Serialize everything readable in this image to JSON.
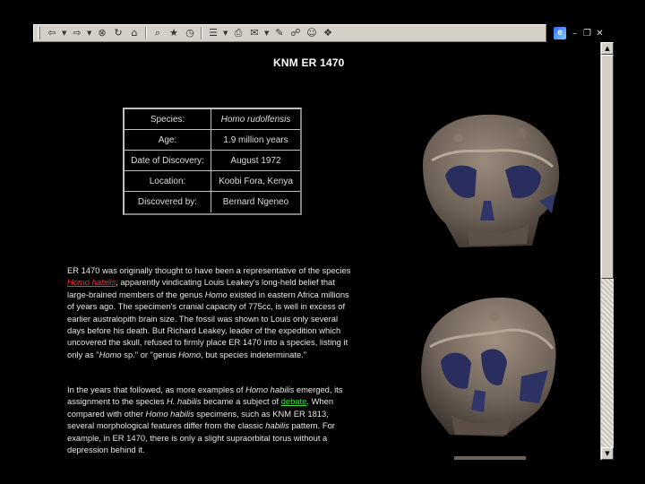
{
  "toolbar": {
    "buttons": [
      {
        "name": "back",
        "glyph": "⇦"
      },
      {
        "name": "forward",
        "glyph": "⇨"
      },
      {
        "name": "stop",
        "glyph": "⊗"
      },
      {
        "name": "refresh",
        "glyph": "↻"
      },
      {
        "name": "home",
        "glyph": "⌂"
      },
      {
        "name": "search",
        "glyph": "⌕"
      },
      {
        "name": "favorites",
        "glyph": "★"
      },
      {
        "name": "history",
        "glyph": "◷"
      },
      {
        "name": "channels",
        "glyph": "☰"
      },
      {
        "name": "print",
        "glyph": "⎙"
      },
      {
        "name": "mail",
        "glyph": "✉"
      },
      {
        "name": "edit",
        "glyph": "✎"
      },
      {
        "name": "discuss",
        "glyph": "☍"
      },
      {
        "name": "messenger",
        "glyph": "☺"
      },
      {
        "name": "research",
        "glyph": "❖"
      }
    ]
  },
  "window": {
    "logo": "e",
    "minimize": "–",
    "restore": "❐",
    "close": "✕"
  },
  "page": {
    "title": "KNM ER 1470",
    "facts": [
      {
        "label": "Species:",
        "value": "Homo rudolfensis",
        "italic": true
      },
      {
        "label": "Age:",
        "value": "1.9 million years",
        "italic": false
      },
      {
        "label": "Date of Discovery:",
        "value": "August 1972",
        "italic": false
      },
      {
        "label": "Location:",
        "value": "Koobi Fora, Kenya",
        "italic": false
      },
      {
        "label": "Discovered by:",
        "value": "Bernard Ngeneo",
        "italic": false
      }
    ],
    "para1": {
      "t1": "ER 1470 was originally thought to have been a representative of the species ",
      "link_habilis": "Homo habilis",
      "t2": ", apparently vindicating Louis Leakey's long-held belief that large-brained members of the genus ",
      "t2_italic": "Homo",
      "t3": " existed in eastern Africa millions of years ago. The specimen's cranial capacity of 775cc, is well in excess of earlier australopith brain size. The fossil was shown to Louis only several days before his death. But Richard Leakey, leader of the expedition which uncovered the skull, refused to firmly place ER 1470 into a species, listing it only as \"",
      "t3_italic": "Homo",
      "t4": " sp.\" or \"genus ",
      "t4_italic": "Homo",
      "t5": ", but species indeterminate.\""
    },
    "para2": {
      "t1": "In the years that followed, as more examples of ",
      "t1_italic": "Homo habilis",
      "t2": " emerged, its assignment to the species ",
      "t2_italic": "H. habilis",
      "t3": " became a subject of ",
      "link_debate": "debate",
      "t4": ". When compared with other ",
      "t4_italic": "Homo habilis",
      "t5": " specimens, such as KNM ER 1813, several morphological features differ from the classic ",
      "t5_italic": "habilis",
      "t6": " pattern. For example, in ER 1470, there is only a slight supraorbital torus without a depression behind it."
    }
  },
  "colors": {
    "background": "#000000",
    "link_red": "#ff3030",
    "link_green": "#40e040",
    "toolbar": "#d4d0c8"
  }
}
